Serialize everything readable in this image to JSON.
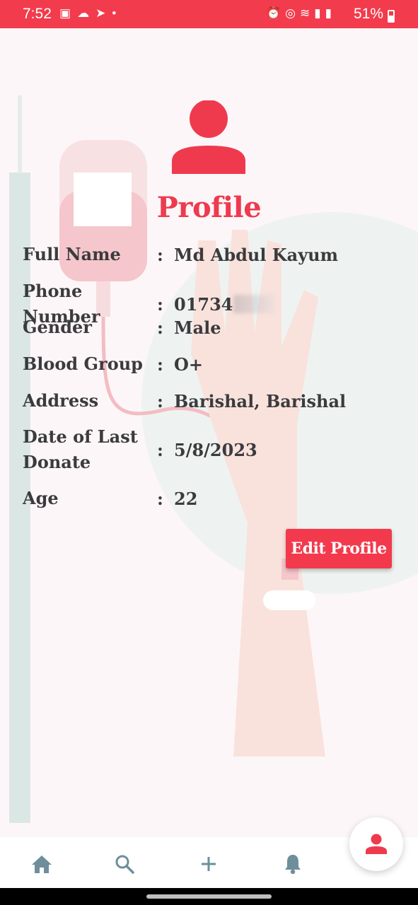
{
  "status_bar": {
    "time": "7:52",
    "battery": "51%",
    "left_icons": [
      "image-icon",
      "weather-icon",
      "send-icon",
      "dot-icon"
    ],
    "right_icons": [
      "alarm-icon",
      "hotspot-icon",
      "wifi-icon",
      "signal-icon",
      "signal-icon"
    ]
  },
  "header": {
    "title": "Profile",
    "avatar_icon": "person-icon"
  },
  "profile": {
    "rows": [
      {
        "label": "Full Name",
        "value": "Md Abdul Kayum"
      },
      {
        "label": "Phone Number",
        "value": "01734"
      },
      {
        "label": "Gender",
        "value": "Male"
      },
      {
        "label": "Blood Group",
        "value": "O+"
      },
      {
        "label": "Address",
        "value": "Barishal, Barishal"
      },
      {
        "label": "Date of Last Donate",
        "value": "5/8/2023"
      },
      {
        "label": "Age",
        "value": "22"
      }
    ],
    "separator": ":"
  },
  "actions": {
    "edit_label": "Edit Profile"
  },
  "bottom_nav": {
    "items": [
      "home-icon",
      "search-icon",
      "plus-icon",
      "bell-icon"
    ],
    "active": "profile-icon"
  },
  "colors": {
    "accent": "#f23b4c",
    "text": "#3b3b3e",
    "nav_icon": "#6f8e9c"
  }
}
